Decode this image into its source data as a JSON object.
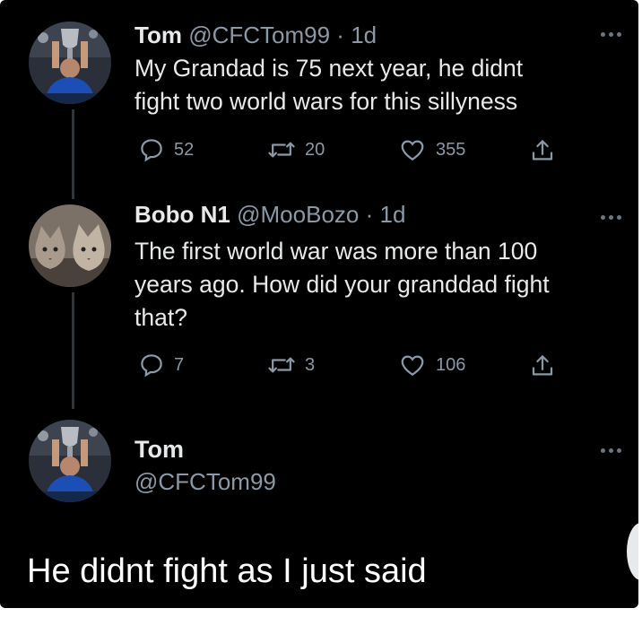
{
  "tweets": [
    {
      "name": "Tom",
      "handle": "@CFCTom99",
      "separator": "·",
      "time": "1d",
      "lines": [
        "My Grandad is 75 next year,  he didnt",
        "fight two world wars for this sillyness"
      ],
      "replies": "52",
      "retweets": "20",
      "likes": "355",
      "avatar_icon": "trophy-player-photo"
    },
    {
      "name": "Bobo N1",
      "handle": "@MooBozo",
      "separator": "·",
      "time": "1d",
      "lines": [
        "The first world war was more than 100",
        "years ago. How did your granddad fight",
        "that?"
      ],
      "replies": "7",
      "retweets": "3",
      "likes": "106",
      "avatar_icon": "two-cats-photo"
    }
  ],
  "reply_author": {
    "name": "Tom",
    "handle": "@CFCTom99",
    "avatar_icon": "trophy-player-photo"
  },
  "reply_text": "He didnt fight as I just said",
  "icons": [
    "reply-icon",
    "retweet-icon",
    "like-icon",
    "share-icon",
    "more-options-icon"
  ],
  "colors": {
    "background": "#000000",
    "text": "#e7e9ea",
    "muted": "#8b98a5",
    "thread_line": "#333639"
  }
}
